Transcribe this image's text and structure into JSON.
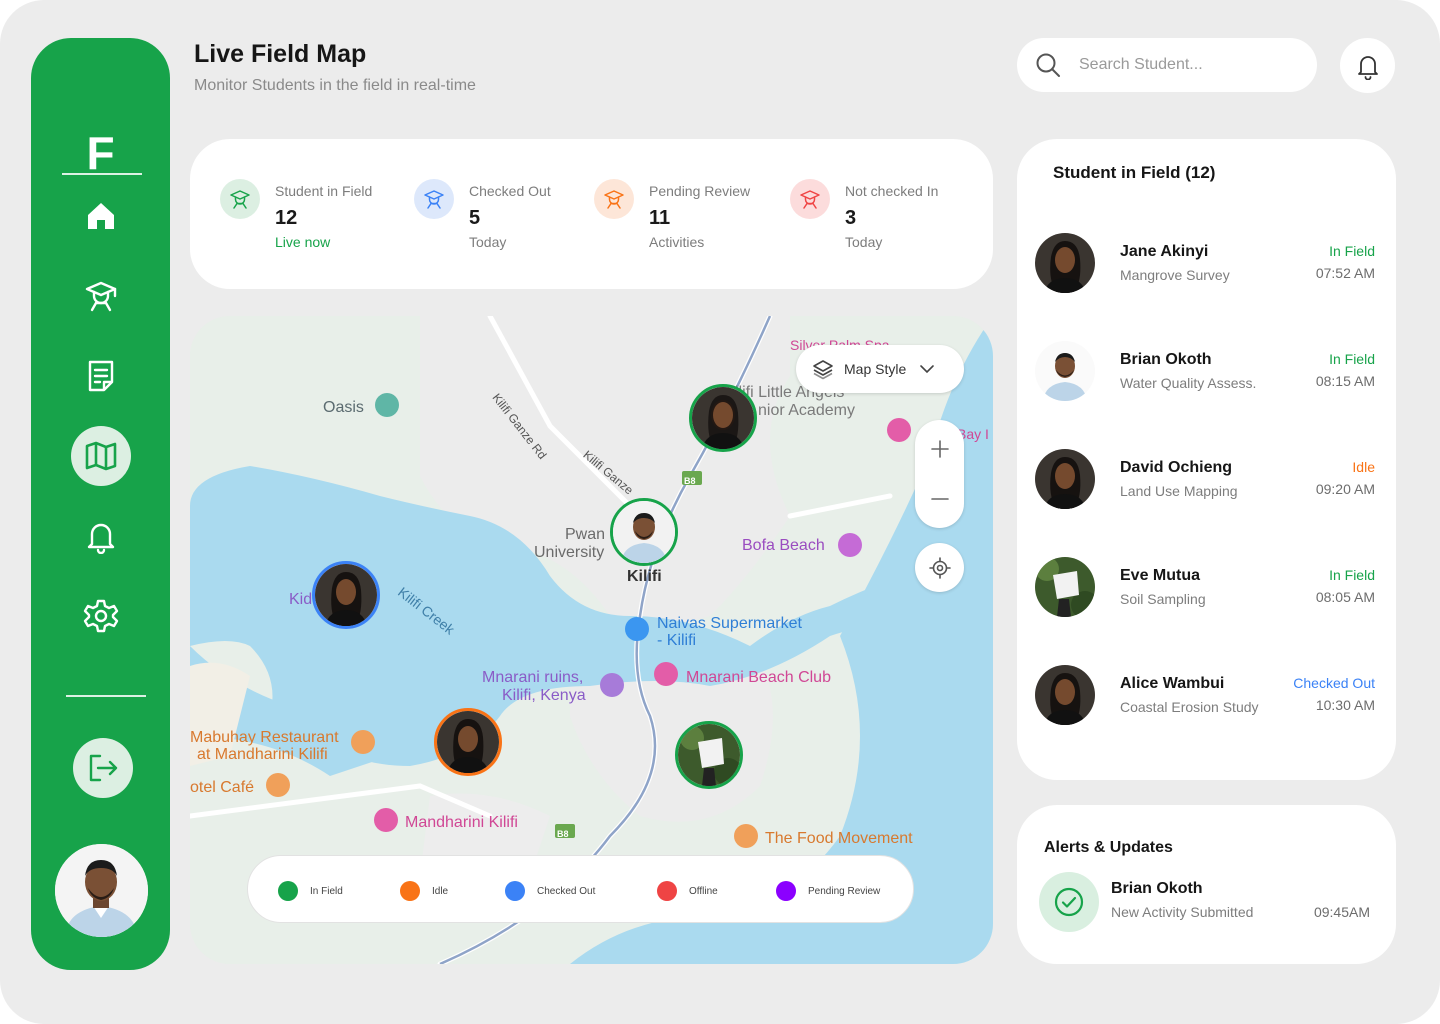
{
  "header": {
    "title": "Live Field Map",
    "subtitle": "Monitor Students in the field in real-time",
    "search_placeholder": "Search Student..."
  },
  "sidebar": {
    "logo": "F",
    "items": [
      {
        "name": "home",
        "icon": "home-icon",
        "active": false
      },
      {
        "name": "students",
        "icon": "student-icon",
        "active": false
      },
      {
        "name": "reports",
        "icon": "document-icon",
        "active": false
      },
      {
        "name": "map",
        "icon": "map-icon",
        "active": true
      },
      {
        "name": "notifications",
        "icon": "bell-icon",
        "active": false
      },
      {
        "name": "settings",
        "icon": "gear-icon",
        "active": false
      }
    ],
    "logout_icon": "logout-icon"
  },
  "stats": [
    {
      "label": "Student in Field",
      "value": "12",
      "sub": "Live now",
      "color": "#17a34a",
      "bg": "#dcefe2",
      "sub_color": "#17a34a"
    },
    {
      "label": "Checked Out",
      "value": "5",
      "sub": "Today",
      "color": "#3b82f6",
      "bg": "#dde8fb",
      "sub_color": "#7d7d7d"
    },
    {
      "label": "Pending Review",
      "value": "11",
      "sub": "Activities",
      "color": "#f97316",
      "bg": "#fde6d8",
      "sub_color": "#7d7d7d"
    },
    {
      "label": "Not checked In",
      "value": "3",
      "sub": "Today",
      "color": "#ef4444",
      "bg": "#fcdcdc",
      "sub_color": "#7d7d7d"
    }
  ],
  "map": {
    "style_label": "Map Style",
    "places": {
      "oasis": "Oasis",
      "pwani_1": "Pwan",
      "pwani_2": "University",
      "kilifi": "Kilifi",
      "bofa": "Bofa Beach",
      "kilifi_creek": "Kilifi Creek",
      "naivas_1": "Naivas Supermarket",
      "naivas_2": "- Kilifi",
      "mnarani_ruins_1": "Mnarani ruins,",
      "mnarani_ruins_2": "Kilifi, Kenya",
      "mnarani_beach": "Mnarani Beach Club",
      "mabuhay_1": "Mabuhay Restaurant",
      "mabuhay_2": "at Mandharini Kilifi",
      "otel_cafe": "otel Café",
      "mandharini": "Mandharini Kilifi",
      "food_movement": "The Food Movement",
      "academy_1": "ilifi Little Angels",
      "academy_2": "nior Academy",
      "silver_palm": "Silver Palm Spa",
      "bay": "Bay I",
      "kid": "Kid",
      "road_1": "Kilifi Ganze Rd",
      "road_2": "Kilifi Ganze",
      "b8": "B8"
    },
    "legend": [
      {
        "label": "In Field",
        "color": "#17a34a"
      },
      {
        "label": "Idle",
        "color": "#f97316"
      },
      {
        "label": "Checked Out",
        "color": "#3b82f6"
      },
      {
        "label": "Offline",
        "color": "#ef4444"
      },
      {
        "label": "Pending Review",
        "color": "#8b00ff"
      }
    ]
  },
  "students_panel": {
    "title": "Student in Field (12)",
    "students": [
      {
        "name": "Jane Akinyi",
        "activity": "Mangrove Survey",
        "status": "In Field",
        "status_color": "#17a34a",
        "time": "07:52 AM"
      },
      {
        "name": "Brian Okoth",
        "activity": "Water Quality Assess.",
        "status": "In Field",
        "status_color": "#17a34a",
        "time": "08:15 AM"
      },
      {
        "name": "David Ochieng",
        "activity": "Land Use Mapping",
        "status": "Idle",
        "status_color": "#f97316",
        "time": "09:20 AM"
      },
      {
        "name": "Eve Mutua",
        "activity": "Soil Sampling",
        "status": "In Field",
        "status_color": "#17a34a",
        "time": "08:05 AM"
      },
      {
        "name": "Alice Wambui",
        "activity": "Coastal Erosion Study",
        "status": "Checked Out",
        "status_color": "#3b82f6",
        "time": "10:30 AM"
      }
    ]
  },
  "alerts": {
    "title": "Alerts & Updates",
    "items": [
      {
        "name": "Brian Okoth",
        "text": "New Activity Submitted",
        "time": "09:45AM"
      }
    ]
  }
}
